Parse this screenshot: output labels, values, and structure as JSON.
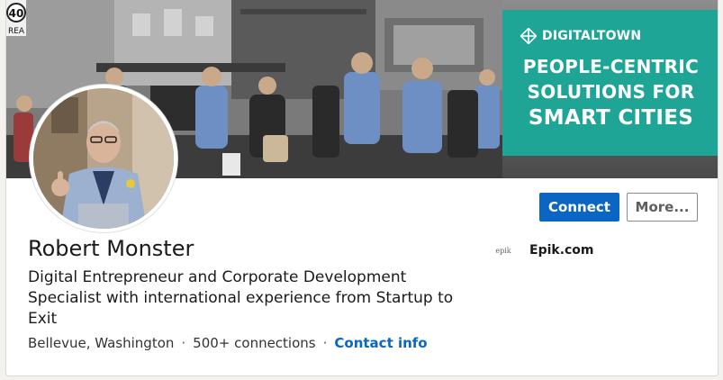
{
  "banner": {
    "brand": "DIGITALTOWN",
    "tagline_lines": [
      "PEOPLE-CENTRIC",
      "SOLUTIONS FOR",
      "SMART CITIES"
    ],
    "sign_number": "40",
    "sign_text": "REA",
    "colors": {
      "promo": "#1ea596"
    }
  },
  "profile": {
    "name": "Robert Monster",
    "headline": "Digital Entrepreneur and Corporate Development Specialist with international experience from Startup to Exit",
    "location": "Bellevue, Washington",
    "separator": "·",
    "connections": "500+ connections",
    "contact_info_label": "Contact info"
  },
  "actions": {
    "connect_label": "Connect",
    "more_label": "More..."
  },
  "company": {
    "logo_text": "epik",
    "name": "Epik.com"
  },
  "icons": {
    "brand": "digitaltown-logo-icon",
    "company": "epik-logo-icon"
  },
  "colors": {
    "accent": "#0a66c2",
    "text": "#1a1a1a"
  }
}
